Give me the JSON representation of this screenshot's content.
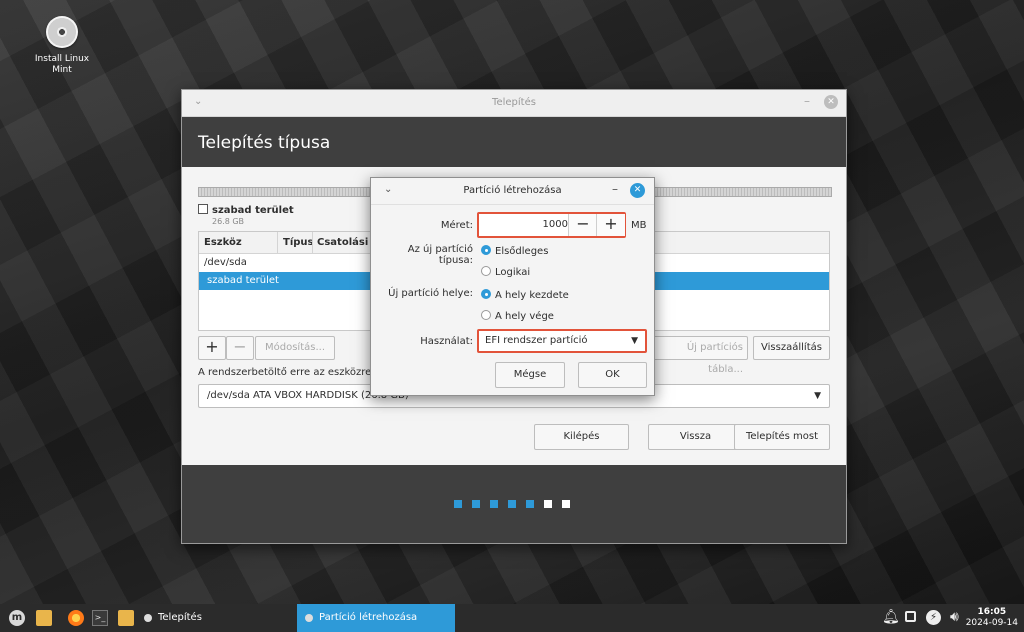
{
  "desktop": {
    "icon_label": "Install Linux Mint"
  },
  "installer": {
    "window_title": "Telepítés",
    "header": "Telepítés típusa",
    "free_space": {
      "label": "szabad terület",
      "size": "26.8 GB"
    },
    "table": {
      "columns": [
        "Eszköz",
        "Típus",
        "Csatolási p"
      ],
      "rows": [
        "/dev/sda",
        "szabad terület"
      ]
    },
    "buttons": {
      "add": "+",
      "remove": "−",
      "change": "Módosítás...",
      "new_table": "Új partíciós tábla...",
      "revert": "Visszaállítás",
      "quit": "Kilépés",
      "back": "Vissza",
      "install_now": "Telepítés most"
    },
    "bootloader_label": "A rendszerbetöltő erre az eszközre ke",
    "bootloader_device": "/dev/sda ATA VBOX HARDDISK (26.8 GB)",
    "progress": {
      "total_steps": 7,
      "completed_steps": 5
    }
  },
  "dialog": {
    "title": "Partíció létrehozása",
    "size_label": "Méret:",
    "size_value": "1000",
    "size_minus": "−",
    "size_plus": "+",
    "size_unit": "MB",
    "type_label": "Az új partíció típusa:",
    "type_primary": "Elsődleges",
    "type_logical": "Logikai",
    "location_label": "Új partíció helye:",
    "location_start": "A hely kezdete",
    "location_end": "A hely vége",
    "use_label": "Használat:",
    "use_value": "EFI rendszer partíció",
    "cancel": "Mégse",
    "ok": "OK"
  },
  "taskbar": {
    "menu_glyph": "m",
    "terminal_glyph": ">_",
    "tasks": [
      "Telepítés",
      "Partíció létrehozása"
    ],
    "time": "16:05",
    "date": "2024-09-14"
  },
  "colors": {
    "accent": "#2e9ad8",
    "highlight_border": "#e2533a",
    "header_bg": "#3f3f3f"
  }
}
